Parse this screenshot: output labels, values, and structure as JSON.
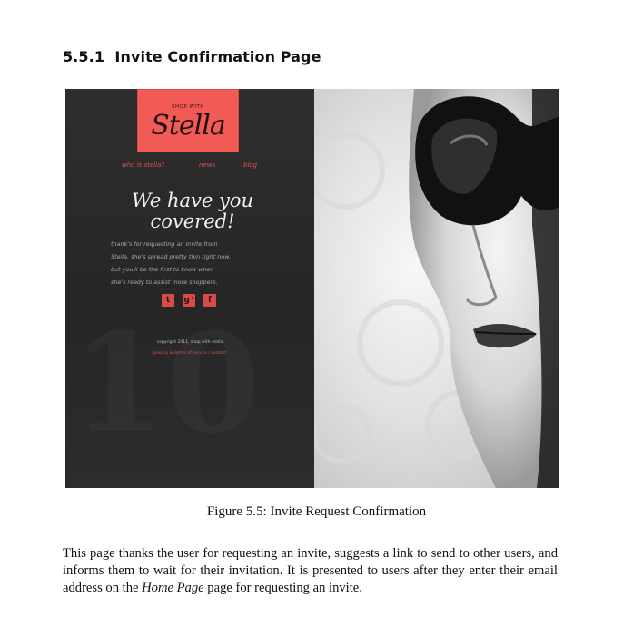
{
  "section": {
    "number": "5.5.1",
    "title": "Invite Confirmation Page"
  },
  "figure_ui": {
    "logo_top": "SHOP WITH",
    "logo_script": "Stella",
    "nav": [
      "who is stella?",
      "news",
      "blog"
    ],
    "headline_line1": "We have you",
    "headline_line2": "covered!",
    "body_lines": [
      "thank's for requesting an invite from",
      "Stella. she's spread pretty thin right now,",
      "but you'll be the first to know when",
      "she's ready to assist more shoppers."
    ],
    "social_icons": [
      {
        "icon": "twitter-icon",
        "glyph": "t"
      },
      {
        "icon": "google-plus-icon",
        "glyph": "g⁺"
      },
      {
        "icon": "facebook-icon",
        "glyph": "f"
      }
    ],
    "copyright": "copyright 2011, shop with stella",
    "footer_links": "privacy & terms of service / contact",
    "accent_color": "#f25a55"
  },
  "caption": "Figure 5.5: Invite Request Confirmation",
  "paragraph_part1": "This page thanks the user for requesting an invite, suggests a link to send to other users, and informs them to wait for their invitation. It is presented to users after they enter their email address on the ",
  "paragraph_emph": "Home Page",
  "paragraph_part2": " page for requesting an invite."
}
